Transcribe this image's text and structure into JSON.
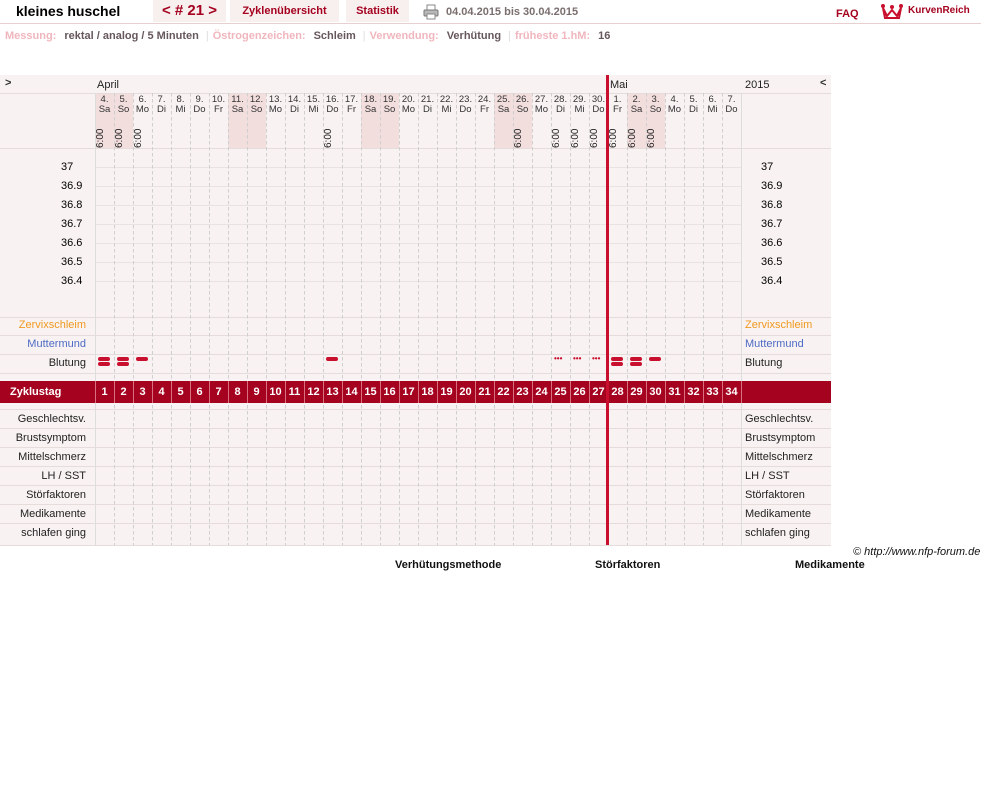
{
  "header": {
    "title": "kleines huschel",
    "cycle": "< # 21 >",
    "overview_label": "Zyklenübersicht",
    "statistics_label": "Statistik",
    "date_range": "04.04.2015 bis 30.04.2015",
    "faq_label": "FAQ",
    "logo_text": "KurvenReich"
  },
  "params": [
    {
      "label": "Messung:",
      "value": "rektal / analog / 5 Minuten"
    },
    {
      "label": "Östrogenzeichen:",
      "value": "Schleim"
    },
    {
      "label": "Verwendung:",
      "value": "Verhütung"
    },
    {
      "label": "früheste 1.hM:",
      "value": "16"
    }
  ],
  "chart": {
    "nav_prev": ">",
    "nav_next": "<",
    "year": "2015",
    "months": [
      {
        "name": "April",
        "start_index": 0
      },
      {
        "name": "Mai",
        "start_index": 27
      }
    ],
    "day_numbers": [
      "4.",
      "5.",
      "6.",
      "7.",
      "8.",
      "9.",
      "10.",
      "11.",
      "12.",
      "13.",
      "14.",
      "15.",
      "16.",
      "17.",
      "18.",
      "19.",
      "20.",
      "21.",
      "22.",
      "23.",
      "24.",
      "25.",
      "26.",
      "27.",
      "28.",
      "29.",
      "30.",
      "1.",
      "2.",
      "3.",
      "4.",
      "5.",
      "6.",
      "7."
    ],
    "day_names": [
      "Sa",
      "So",
      "Mo",
      "Di",
      "Mi",
      "Do",
      "Fr",
      "Sa",
      "So",
      "Mo",
      "Di",
      "Mi",
      "Do",
      "Fr",
      "Sa",
      "So",
      "Mo",
      "Di",
      "Mi",
      "Do",
      "Fr",
      "Sa",
      "So",
      "Mo",
      "Di",
      "Mi",
      "Do",
      "Fr",
      "Sa",
      "So",
      "Mo",
      "Di",
      "Mi",
      "Do"
    ],
    "weekend_indexes": [
      0,
      1,
      7,
      8,
      14,
      15,
      21,
      22,
      28,
      29
    ],
    "measurement_times": [
      {
        "index": 0,
        "time": "6:00"
      },
      {
        "index": 1,
        "time": "6:00"
      },
      {
        "index": 2,
        "time": "6:00"
      },
      {
        "index": 12,
        "time": "6:00"
      },
      {
        "index": 22,
        "time": "6:00"
      },
      {
        "index": 24,
        "time": "6:00"
      },
      {
        "index": 25,
        "time": "6:00"
      },
      {
        "index": 26,
        "time": "6:00"
      },
      {
        "index": 27,
        "time": "6:00"
      },
      {
        "index": 28,
        "time": "6:00"
      },
      {
        "index": 29,
        "time": "6:00"
      }
    ],
    "temperature_labels": [
      "37",
      "36.9",
      "36.8",
      "36.7",
      "36.6",
      "36.5",
      "36.4"
    ],
    "row_labels": {
      "cervical_mucus": "Zervixschleim",
      "cervix": "Muttermund",
      "bleeding": "Blutung",
      "cycle_day": "Zyklustag"
    },
    "bleeding": [
      {
        "index": 0,
        "level": "heavy"
      },
      {
        "index": 1,
        "level": "heavy"
      },
      {
        "index": 2,
        "level": "light"
      },
      {
        "index": 12,
        "level": "light"
      },
      {
        "index": 24,
        "level": "spotting"
      },
      {
        "index": 25,
        "level": "spotting"
      },
      {
        "index": 26,
        "level": "spotting"
      },
      {
        "index": 27,
        "level": "heavy"
      },
      {
        "index": 28,
        "level": "heavy"
      },
      {
        "index": 29,
        "level": "light"
      }
    ],
    "cycle_days": [
      "1",
      "2",
      "3",
      "4",
      "5",
      "6",
      "7",
      "8",
      "9",
      "10",
      "11",
      "12",
      "13",
      "14",
      "15",
      "16",
      "17",
      "18",
      "19",
      "20",
      "21",
      "22",
      "23",
      "24",
      "25",
      "26",
      "27",
      "28",
      "29",
      "30",
      "31",
      "32",
      "33",
      "34"
    ],
    "bottom_rows": [
      "Geschlechtsv.",
      "Brustsymptom",
      "Mittelschmerz",
      "LH / SST",
      "Störfaktoren",
      "Medikamente",
      "schlafen ging"
    ],
    "today_index": 27
  },
  "footer": {
    "copyright": "© http://www.nfp-forum.de",
    "sections": [
      "Verhütungsmethode",
      "Störfaktoren",
      "Medikamente"
    ]
  },
  "colors": {
    "accent": "#a4021f",
    "bleeding": "#c8102e",
    "mucus": "#ef9a21",
    "cervix": "#4d6bc4"
  }
}
